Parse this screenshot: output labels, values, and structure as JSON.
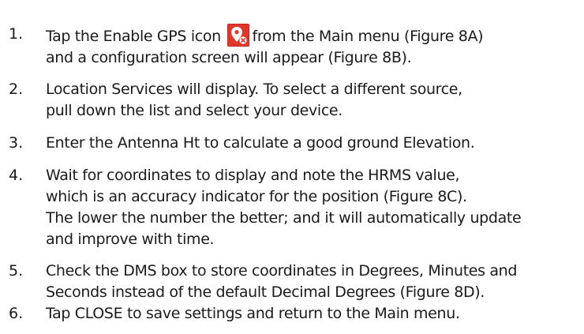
{
  "steps": [
    {
      "number": "1.",
      "line1_before_icon": "Tap the Enable GPS icon",
      "line1_after_icon": "from the Main menu (Figure 8A)",
      "line2": "and a configuration screen will appear (Figure 8B).",
      "icon": "gps-location-pin-icon"
    },
    {
      "number": "2.",
      "lines": [
        "Location Services will display. To select a different source,",
        "pull down the list and select your device."
      ]
    },
    {
      "number": "3.",
      "lines": [
        "Enter the Antenna Ht to calculate a good ground Elevation."
      ]
    },
    {
      "number": "4.",
      "lines": [
        "Wait for coordinates to display and note the HRMS value,",
        "which is an accuracy indicator for the position (Figure 8C).",
        "The lower the number the better; and it will automatically update",
        "and improve with time."
      ]
    },
    {
      "number": "5.",
      "lines": [
        "Check the DMS box to store coordinates in Degrees, Minutes and",
        "Seconds instead of the default Decimal Degrees (Figure 8D)."
      ]
    },
    {
      "number": "6.",
      "lines": [
        "Tap CLOSE to save settings and return to the Main menu."
      ]
    }
  ],
  "colors": {
    "icon_background": "#e1372b",
    "text": "#1a1a1a"
  }
}
